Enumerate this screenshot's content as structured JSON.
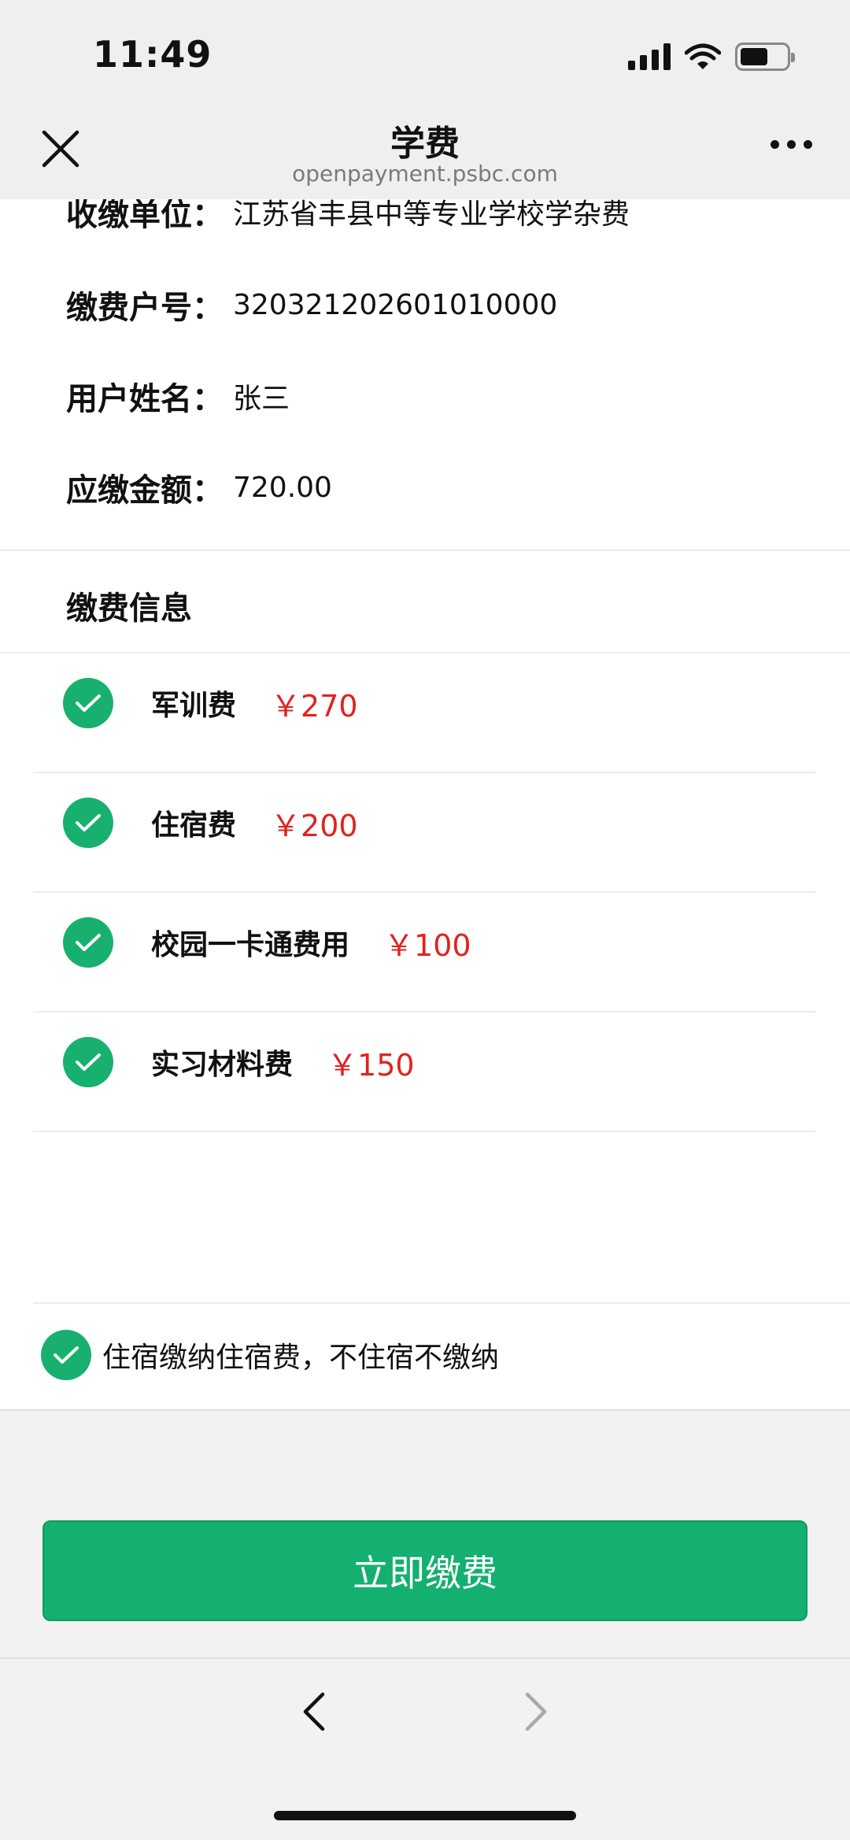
{
  "status_bar": {
    "time": "11:49"
  },
  "nav": {
    "title": "学费",
    "url": "openpayment.psbc.com"
  },
  "info": {
    "payee_label": "收缴单位：",
    "payee_value": "江苏省丰县中等专业学校学杂费",
    "account_label": "缴费户号：",
    "account_value": "320321202601010000",
    "name_label": "用户姓名：",
    "name_value": "张三",
    "amount_label": "应缴金额：",
    "amount_value": "720.00"
  },
  "section": {
    "title": "缴费信息"
  },
  "fees": [
    {
      "name": "军训费",
      "amount": "￥270",
      "checked": true
    },
    {
      "name": "住宿费",
      "amount": "￥200",
      "checked": true
    },
    {
      "name": "校园一卡通费用",
      "amount": "￥100",
      "checked": true
    },
    {
      "name": "实习材料费",
      "amount": "￥150",
      "checked": true
    }
  ],
  "agreement": {
    "text": "住宿缴纳住宿费，不住宿不缴纳",
    "checked": true
  },
  "actions": {
    "pay_label": "立即缴费"
  },
  "colors": {
    "accent": "#13b06f",
    "price": "#e0231f"
  }
}
